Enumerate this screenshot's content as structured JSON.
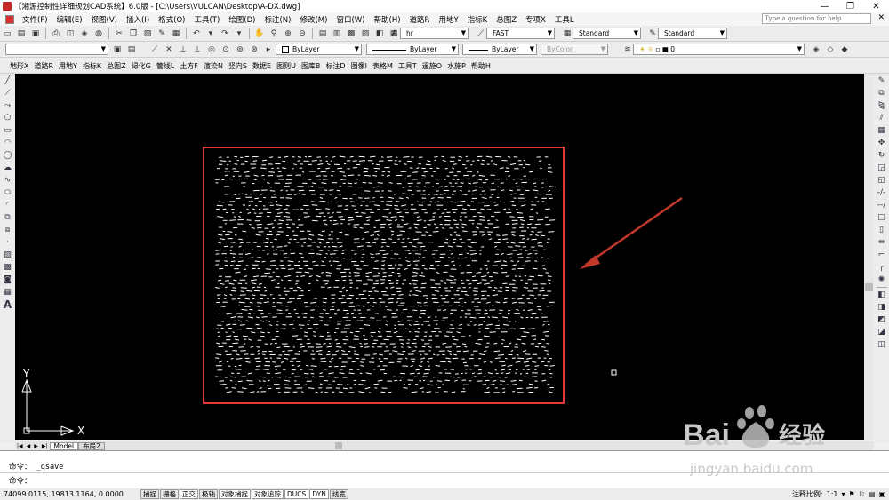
{
  "title": "【湘源控制性详细规划CAD系统】6.0版 - [C:\\Users\\VULCAN\\Desktop\\A-DX.dwg]",
  "window_controls": [
    "—",
    "❐",
    "✕"
  ],
  "menu": [
    "文件(F)",
    "编辑(E)",
    "视图(V)",
    "插入(I)",
    "格式(O)",
    "工具(T)",
    "绘图(D)",
    "标注(N)",
    "修改(M)",
    "窗口(W)",
    "帮助(H)",
    "道路R",
    "用地Y",
    "指标K",
    "总图Z",
    "专项X",
    "工具L"
  ],
  "help_placeholder": "Type a question for help",
  "toolbar1": {
    "text_style": "hr",
    "dim_style": "FAST",
    "table_style": "Standard",
    "multileader_style": "Standard"
  },
  "toolbar2": {
    "view_combo": "",
    "color": "ByLayer",
    "linetype": "ByLayer",
    "lineweight": "ByLayer",
    "plotstyle": "ByColor",
    "layer": "0"
  },
  "plugin_menu": [
    "地形X",
    "道路R",
    "用地Y",
    "指标K",
    "总图Z",
    "绿化G",
    "管线L",
    "土方F",
    "渲染N",
    "竖向S",
    "数据E",
    "图则U",
    "图库B",
    "标注D",
    "图像I",
    "表格M",
    "工具T",
    "遥施O",
    "水施P",
    "帮助H"
  ],
  "ucs": {
    "y_label": "Y",
    "x_label": "X"
  },
  "colors": {
    "highlight": "#e53935",
    "arrow": "#c0392b",
    "canvas": "#000000",
    "drawing_lines": "#ffffff"
  },
  "tabs": [
    "Model",
    "布局2"
  ],
  "command_history": [
    "命令： _qsave",
    "命令："
  ],
  "coordinates": "74099.0115, 19813.1164, 0.0000",
  "status_toggles": [
    "捕捉",
    "栅格",
    "正交",
    "极轴",
    "对象捕捉",
    "对象追踪",
    "DUCS",
    "DYN",
    "线宽"
  ],
  "status_right": {
    "scale_label": "注释比例:",
    "scale_value": "1:1"
  },
  "watermark": {
    "brand": "Bai",
    "brand_cn": "经验",
    "url": "jingyan.baidu.com"
  }
}
